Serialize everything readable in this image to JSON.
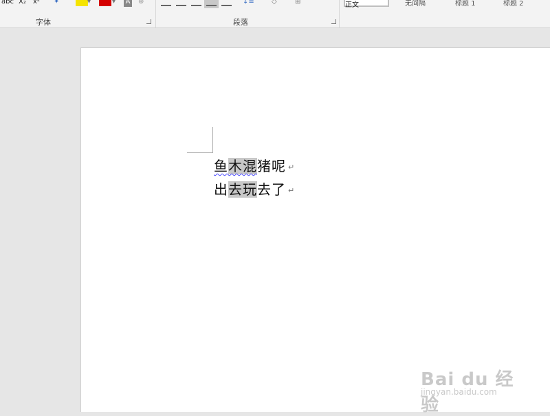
{
  "ribbon": {
    "font_group_label": "字体",
    "paragraph_group_label": "段落",
    "font_buttons": {
      "strikethrough": "abc",
      "subscript": "X₂",
      "superscript": "x²",
      "text_effect": "A"
    },
    "styles": [
      "正文",
      "无间隔",
      "标题 1",
      "标题 2"
    ]
  },
  "document": {
    "lines": [
      {
        "pre": "鱼",
        "selected": "木混",
        "post": "猪呢",
        "mark": "↵"
      },
      {
        "pre": "出",
        "selected": "去玩",
        "post": "去了",
        "mark": "↵"
      }
    ]
  },
  "watermark": {
    "logo": "Bai du 经验",
    "url": "jingyan.baidu.com"
  },
  "colors": {
    "highlight": "#f5e400",
    "font_color": "#d40000",
    "selection": "#c8c8c8"
  }
}
